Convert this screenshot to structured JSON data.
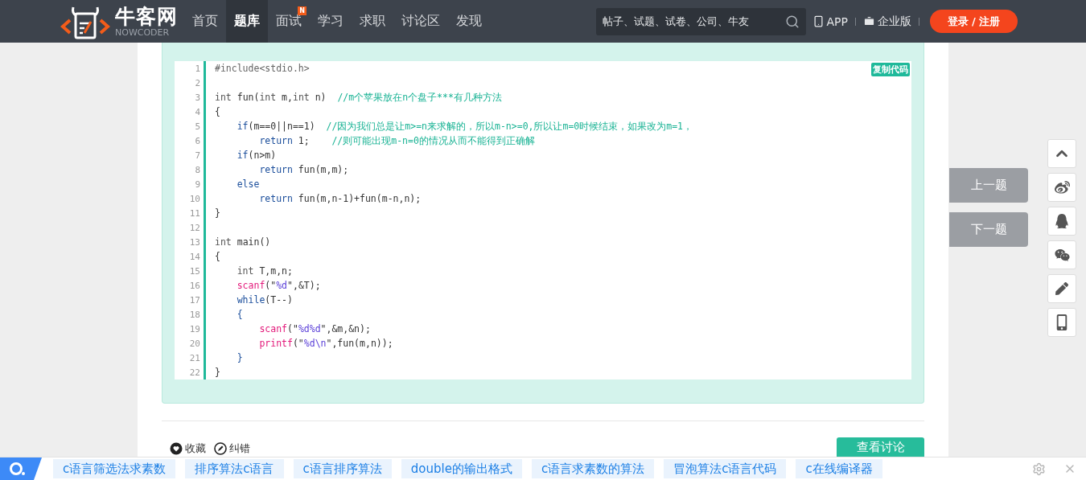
{
  "header": {
    "logo": {
      "name": "牛客网",
      "subtitle": "NOWCODER"
    },
    "nav": [
      {
        "label": "首页",
        "selected": false
      },
      {
        "label": "题库",
        "selected": true
      },
      {
        "label": "面试",
        "selected": false,
        "badge": "N"
      },
      {
        "label": "学习",
        "selected": false
      },
      {
        "label": "求职",
        "selected": false
      },
      {
        "label": "讨论区",
        "selected": false
      },
      {
        "label": "发现",
        "selected": false
      }
    ],
    "search": {
      "placeholder": "帖子、试题、试卷、公司、牛友"
    },
    "links": [
      {
        "kind": "app",
        "label": "APP"
      },
      {
        "kind": "enterprise",
        "label": "企业版"
      }
    ],
    "login": "登录 / 注册"
  },
  "code": {
    "copy_button": "复制代码",
    "lines": [
      {
        "no": "1",
        "tokens": [
          {
            "kind": "pre",
            "text": "#include<stdio.h>"
          }
        ]
      },
      {
        "no": "2"
      },
      {
        "no": "3",
        "tokens": [
          {
            "kind": "type",
            "text": "int"
          },
          {
            "kind": "text",
            "text": " fun("
          },
          {
            "kind": "type",
            "text": "int"
          },
          {
            "kind": "text",
            "text": " m,"
          },
          {
            "kind": "type",
            "text": "int"
          },
          {
            "kind": "text",
            "text": " n)  "
          },
          {
            "kind": "comment",
            "text": "//m个苹果放在n个盘子***有几种方法"
          }
        ]
      },
      {
        "no": "4",
        "tokens": [
          {
            "kind": "text",
            "text": "{"
          }
        ]
      },
      {
        "no": "5",
        "tokens": [
          {
            "kind": "kw",
            "text": "    if"
          },
          {
            "kind": "text",
            "text": "(m==0||n==1)  "
          },
          {
            "kind": "comment",
            "text": "//因为我们总是让m>=n来求解的，所以m-n>=0,所以让m=0时候结束，如果改为m=1，"
          }
        ]
      },
      {
        "no": "6",
        "tokens": [
          {
            "kind": "kw",
            "text": "        return"
          },
          {
            "kind": "text",
            "text": " 1;    "
          },
          {
            "kind": "comment",
            "text": "//则可能出现m-n=0的情况从而不能得到正确解"
          }
        ]
      },
      {
        "no": "7",
        "tokens": [
          {
            "kind": "kw",
            "text": "    if"
          },
          {
            "kind": "text",
            "text": "(n>m)"
          }
        ]
      },
      {
        "no": "8",
        "tokens": [
          {
            "kind": "kw",
            "text": "        return"
          },
          {
            "kind": "text",
            "text": " fun(m,m);"
          }
        ]
      },
      {
        "no": "9",
        "tokens": [
          {
            "kind": "kw",
            "text": "    else"
          }
        ]
      },
      {
        "no": "10",
        "tokens": [
          {
            "kind": "kw",
            "text": "        return"
          },
          {
            "kind": "text",
            "text": " fun(m,n-1)+fun(m-n,n);"
          }
        ]
      },
      {
        "no": "11",
        "tokens": [
          {
            "kind": "text",
            "text": "}"
          }
        ]
      },
      {
        "no": "12"
      },
      {
        "no": "13",
        "tokens": [
          {
            "kind": "type",
            "text": "int"
          },
          {
            "kind": "text",
            "text": " main()"
          }
        ]
      },
      {
        "no": "14",
        "tokens": [
          {
            "kind": "text",
            "text": "{"
          }
        ]
      },
      {
        "no": "15",
        "tokens": [
          {
            "kind": "type",
            "text": "    int"
          },
          {
            "kind": "text",
            "text": " T,m,n;"
          }
        ]
      },
      {
        "no": "16",
        "tokens": [
          {
            "kind": "fn",
            "text": "    scanf"
          },
          {
            "kind": "text",
            "text": "(\""
          },
          {
            "kind": "str",
            "text": "%d"
          },
          {
            "kind": "text",
            "text": "\",&T);"
          }
        ]
      },
      {
        "no": "17",
        "tokens": [
          {
            "kind": "kw",
            "text": "    while"
          },
          {
            "kind": "text",
            "text": "(T--)"
          }
        ]
      },
      {
        "no": "18",
        "tokens": [
          {
            "kind": "kw",
            "text": "    {"
          }
        ]
      },
      {
        "no": "19",
        "tokens": [
          {
            "kind": "fn",
            "text": "        scanf"
          },
          {
            "kind": "text",
            "text": "(\""
          },
          {
            "kind": "str",
            "text": "%d%d"
          },
          {
            "kind": "text",
            "text": "\",&m,&n);"
          }
        ]
      },
      {
        "no": "20",
        "tokens": [
          {
            "kind": "fn",
            "text": "        printf"
          },
          {
            "kind": "text",
            "text": "(\""
          },
          {
            "kind": "str",
            "text": "%d\\n"
          },
          {
            "kind": "text",
            "text": "\",fun(m,n));"
          }
        ]
      },
      {
        "no": "21",
        "tokens": [
          {
            "kind": "kw",
            "text": "    }"
          }
        ]
      },
      {
        "no": "22",
        "tokens": [
          {
            "kind": "text",
            "text": "}"
          }
        ]
      }
    ]
  },
  "actions": [
    {
      "kind": "favorite",
      "label": "收藏"
    },
    {
      "kind": "report",
      "label": "纠错"
    }
  ],
  "discuss_button": "查看讨论",
  "question_nav": [
    "上一题",
    "下一题"
  ],
  "side_tools": [
    {
      "kind": "top"
    },
    {
      "kind": "weibo"
    },
    {
      "kind": "qq"
    },
    {
      "kind": "wechat"
    },
    {
      "kind": "edit"
    },
    {
      "kind": "mobile"
    }
  ],
  "bottom_bar": {
    "tags": [
      "c语言筛选法求素数",
      "排序算法c语言",
      "c语言排序算法",
      "double的输出格式",
      "c语言求素数的算法",
      "冒泡算法c语言代码",
      "c在线编译器"
    ]
  }
}
